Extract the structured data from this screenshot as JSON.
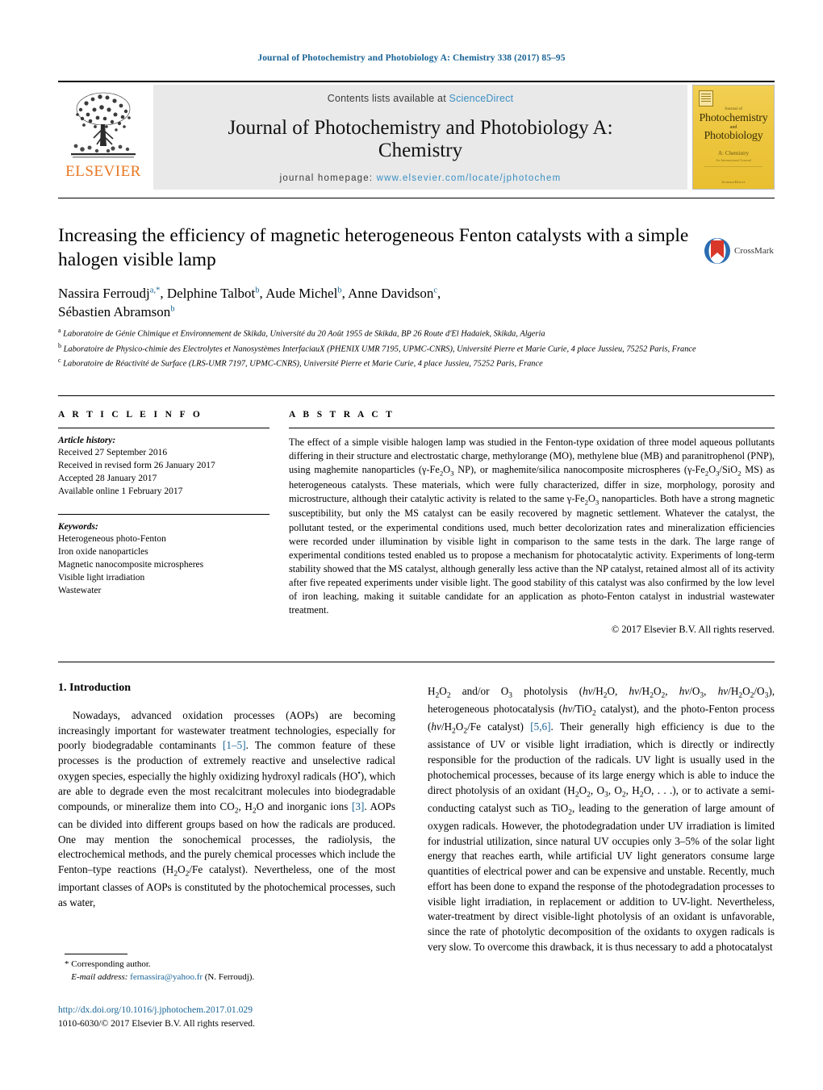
{
  "running_header": "Journal of Photochemistry and Photobiology A: Chemistry 338 (2017) 85–95",
  "masthead": {
    "publisher_name": "ELSEVIER",
    "contents_prefix": "Contents lists available at ",
    "contents_link": "ScienceDirect",
    "journal_title_line1": "Journal of Photochemistry and Photobiology A:",
    "journal_title_line2": "Chemistry",
    "homepage_prefix": "journal homepage: ",
    "homepage_url": "www.elsevier.com/locate/jphotochem",
    "cover": {
      "sub_top": "Journal of",
      "line1": "Photochemistry",
      "line2": "and",
      "line3": "Photobiology",
      "chem": "A: Chemistry",
      "issn": "An International Journal",
      "footer": "ScienceDirect"
    }
  },
  "article": {
    "title": "Increasing the efficiency of magnetic heterogeneous Fenton catalysts with a simple halogen visible lamp",
    "crossmark_label": "CrossMark",
    "authors": [
      {
        "name": "Nassira Ferroudj",
        "marks": "a,*"
      },
      {
        "name": "Delphine Talbot",
        "marks": "b"
      },
      {
        "name": "Aude Michel",
        "marks": "b"
      },
      {
        "name": "Anne Davidson",
        "marks": "c"
      },
      {
        "name": "Sébastien Abramson",
        "marks": "b"
      }
    ],
    "affiliations": [
      {
        "mark": "a",
        "text": "Laboratoire de Génie Chimique et Environnement de Skikda, Université du 20 Août 1955 de Skikda, BP 26 Route d'El Hadaiek, Skikda, Algeria"
      },
      {
        "mark": "b",
        "text": "Laboratoire de Physico-chimie des Electrolytes et Nanosystèmes InterfaciauX (PHENIX UMR 7195, UPMC-CNRS), Université Pierre et Marie Curie, 4 place Jussieu, 75252 Paris, France"
      },
      {
        "mark": "c",
        "text": "Laboratoire de Réactivité de Surface (LRS-UMR 7197, UPMC-CNRS), Université Pierre et Marie Curie, 4 place Jussieu, 75252 Paris, France"
      }
    ]
  },
  "article_info": {
    "heading": "A R T I C L E  I N F O",
    "history_label": "Article history:",
    "history": [
      "Received 27 September 2016",
      "Received in revised form 26 January 2017",
      "Accepted 28 January 2017",
      "Available online 1 February 2017"
    ],
    "keywords_label": "Keywords:",
    "keywords": [
      "Heterogeneous photo-Fenton",
      "Iron oxide nanoparticles",
      "Magnetic nanocomposite microspheres",
      "Visible light irradiation",
      "Wastewater"
    ]
  },
  "abstract": {
    "heading": "A B S T R A C T",
    "copyright": "© 2017 Elsevier B.V. All rights reserved."
  },
  "sections": {
    "introduction_heading": "1. Introduction"
  },
  "footnote": {
    "corresponding": "* Corresponding author.",
    "email_label": "E-mail address:",
    "email": "fernassira@yahoo.fr",
    "email_owner": "(N. Ferroudj)."
  },
  "footer": {
    "doi": "http://dx.doi.org/10.1016/j.jphotochem.2017.01.029",
    "issn_copyright": "1010-6030/© 2017 Elsevier B.V. All rights reserved."
  },
  "colors": {
    "link_blue": "#1a6496",
    "header_blue": "#1a6496",
    "elsevier_orange": "#E87722",
    "band_gray": "#e9e9e9",
    "cover_yellow": "#edc63f"
  }
}
